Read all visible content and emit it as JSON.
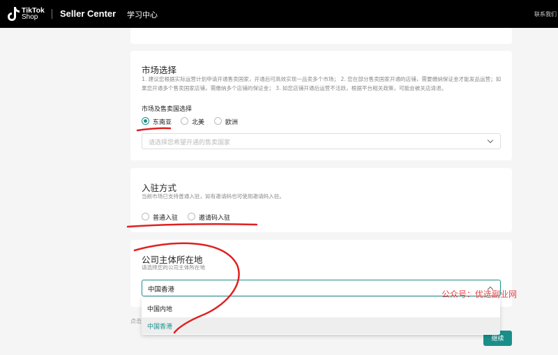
{
  "header": {
    "logo_line1": "TikTok",
    "logo_line2": "Shop",
    "app_title": "Seller Center",
    "learning_center": "学习中心",
    "contact": "联系我们"
  },
  "market": {
    "title": "市场选择",
    "description": "1. 建议您根据实际运营计划申请开通售卖国家，开通后可高效实现一品卖多个市场； 2. 您在部分售卖国家开通的店铺，需要缴纳保证金才能发品运营；如果您开通多个售卖国家店铺，需缴纳多个店铺的保证金； 3. 如您店铺开通后运营不活跃，根据平台相关政策，可能会被关店清退。",
    "field_label": "市场及售卖国选择",
    "options": [
      "东南亚",
      "北美",
      "欧洲"
    ],
    "selected": "东南亚",
    "country_placeholder": "请选择您希望开通的售卖国家"
  },
  "entry": {
    "title": "入驻方式",
    "description": "当前市场已支持普通入驻，如有邀请码也可使用邀请码入驻。",
    "options": [
      "普通入驻",
      "邀请码入驻"
    ]
  },
  "company": {
    "title": "公司主体所在地",
    "description": "请选择您的公司主体所在地",
    "value": "中国香港",
    "dropdown_options": [
      "中国内地",
      "中国香港"
    ],
    "selected": "中国香港"
  },
  "footer": {
    "hint": "点击",
    "continue_label": "继续"
  },
  "watermark": "公众号：优选副业网",
  "colors": {
    "accent": "#1a8f8a",
    "header_bg": "#000000",
    "annotation": "#e02020"
  }
}
